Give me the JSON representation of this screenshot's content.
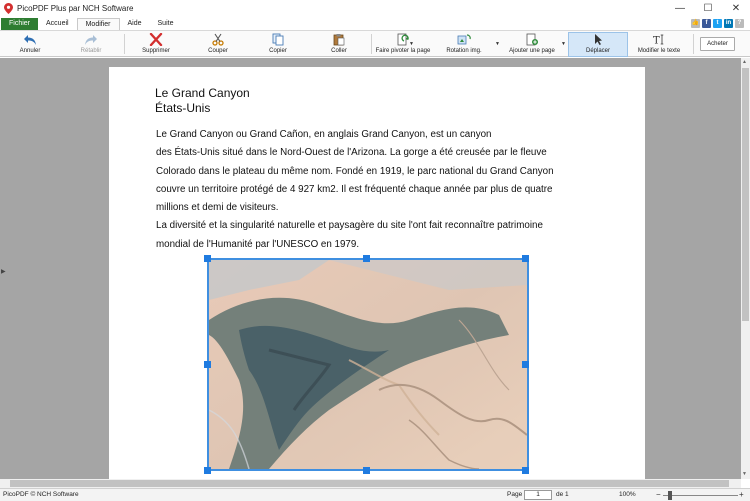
{
  "window": {
    "title": "PicoPDF Plus par NCH Software"
  },
  "menu": {
    "file": "Fichier",
    "tabs": [
      "Accueil",
      "Modifier",
      "Aide",
      "Suite"
    ],
    "active_tab": "Modifier"
  },
  "toolbar": {
    "undo": "Annuler",
    "redo": "Rétablir",
    "delete": "Supprimer",
    "cut": "Couper",
    "copy": "Copier",
    "paste": "Coller",
    "rotate_page": "Faire pivoter la page",
    "rotate_image": "Rotation img.",
    "add_page": "Ajouter une page",
    "move": "Déplacer",
    "edit_text": "Modifier le texte",
    "buy": "Acheter"
  },
  "document": {
    "title_line1": "Le Grand Canyon",
    "title_line2": "États-Unis",
    "lines": [
      "Le Grand Canyon ou Grand Cañon, en anglais Grand Canyon, est un canyon",
      "des États-Unis situé dans le Nord-Ouest de l'Arizona. La gorge a été creusée par le fleuve",
      "Colorado dans le plateau du même nom. Fondé en 1919, le parc national du Grand Canyon",
      "couvre un territoire protégé de 4 927 km2. Il est fréquenté chaque année par plus de quatre",
      "millions et demi de visiteurs.",
      "La diversité et la singularité naturelle et paysagère du site l'ont fait reconnaître patrimoine",
      "mondial de l'Humanité par l'UNESCO en 1979."
    ]
  },
  "status": {
    "copyright": "PicoPDF © NCH Software",
    "page_label": "Page",
    "page_value": "1",
    "of_label": "de 1",
    "zoom": "100%"
  },
  "colors": {
    "file_tab": "#2e7d32",
    "selection": "#3f8fe0",
    "workspace": "#a5a5a5"
  }
}
